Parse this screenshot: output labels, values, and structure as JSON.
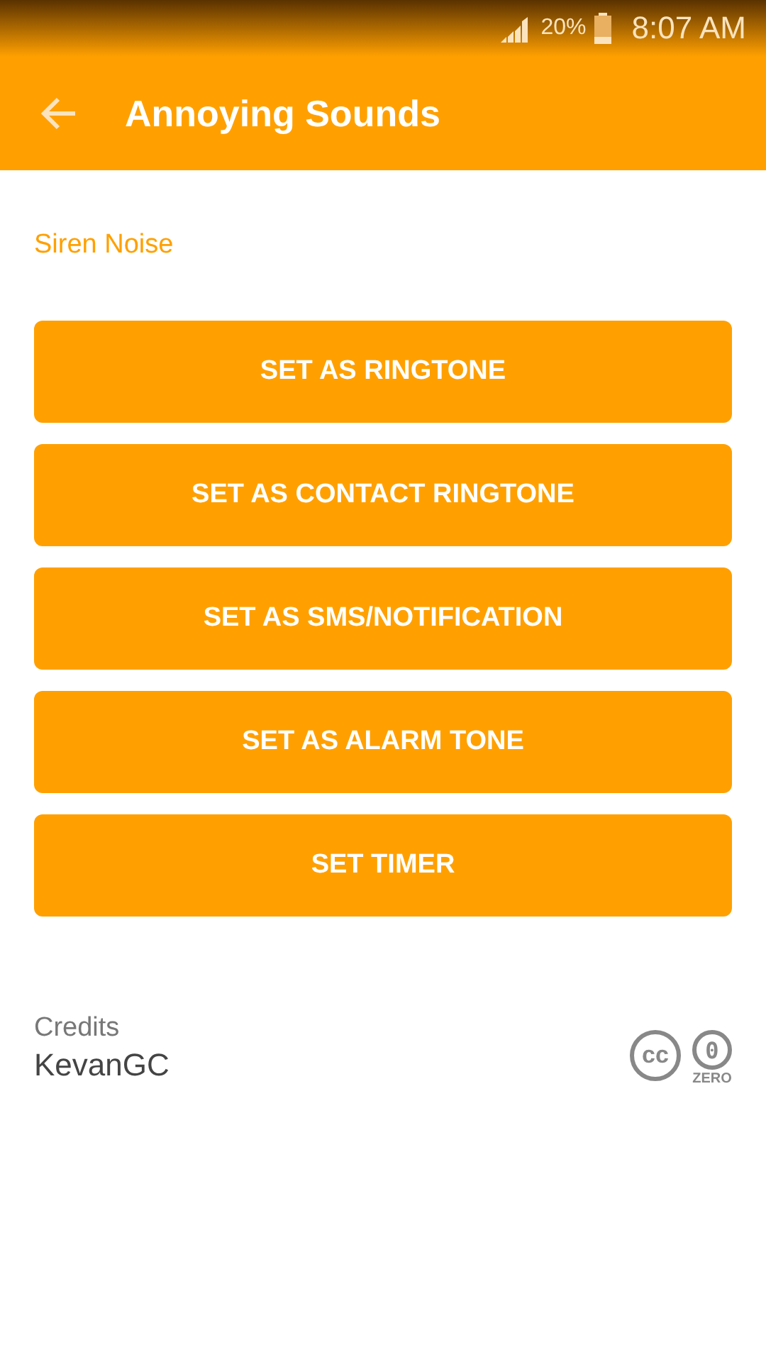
{
  "status_bar": {
    "battery": "20%",
    "time": "8:07 AM"
  },
  "app_bar": {
    "title": "Annoying Sounds"
  },
  "sound_name": "Siren Noise",
  "buttons": [
    "SET AS RINGTONE",
    "SET AS CONTACT RINGTONE",
    "SET AS SMS/NOTIFICATION",
    "SET AS ALARM TONE",
    "SET TIMER"
  ],
  "credits": {
    "label": "Credits",
    "author": "KevanGC",
    "license": {
      "cc": "cc",
      "zero_digit": "0",
      "zero_label": "ZERO"
    }
  }
}
